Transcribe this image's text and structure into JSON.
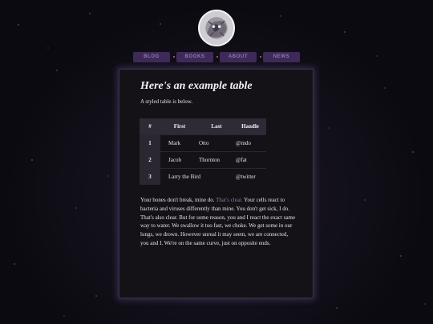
{
  "nav": {
    "items": [
      {
        "label": "Blog"
      },
      {
        "label": "Books"
      },
      {
        "label": "About"
      },
      {
        "label": "News"
      }
    ]
  },
  "card": {
    "title": "Here's an example table",
    "subtitle": "A styled table is below.",
    "table": {
      "headers": [
        "#",
        "First",
        "Last",
        "Handle"
      ],
      "rows": [
        [
          "1",
          "Mark",
          "Otto",
          "@mdo"
        ],
        [
          "2",
          "Jacob",
          "Thornton",
          "@fat"
        ],
        [
          "3",
          "Larry the Bird",
          "",
          "@twitter"
        ]
      ]
    },
    "paragraph": {
      "before": "Your bones don't break, mine do. ",
      "link": "That's clear.",
      "after": " Your cells react to bacteria and viruses differently than mine. You don't get sick, I do. That's also clear. But for some reason, you and I react the exact same way to water. We swallow it too fast, we choke. We get some in our lungs, we drown. However unreal it may seem, we are connected, you and I. We're on the same curve, just on opposite ends."
    }
  },
  "colors": {
    "background": "#0b0a10",
    "nav_button": "#3e2a58",
    "nav_text": "#8f7ab0",
    "card_bg": "#141216",
    "card_glow": "#6e5096",
    "table_header": "#2e2b36",
    "link": "#8a7aa6"
  },
  "icons": {
    "avatar": "avatar-image"
  }
}
